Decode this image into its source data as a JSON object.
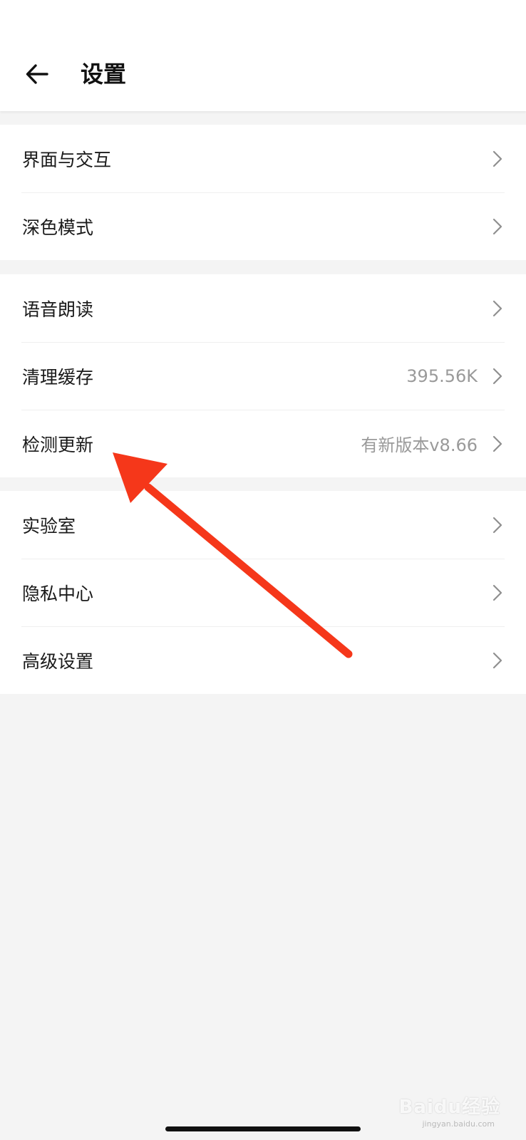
{
  "header": {
    "title": "设置",
    "back_icon": "arrow-left-icon"
  },
  "groups": [
    {
      "items": [
        {
          "label": "界面与交互",
          "value": ""
        },
        {
          "label": "深色模式",
          "value": ""
        }
      ]
    },
    {
      "items": [
        {
          "label": "语音朗读",
          "value": ""
        },
        {
          "label": "清理缓存",
          "value": "395.56K"
        },
        {
          "label": "检测更新",
          "value": "有新版本v8.66"
        }
      ]
    },
    {
      "items": [
        {
          "label": "实验室",
          "value": ""
        },
        {
          "label": "隐私中心",
          "value": ""
        },
        {
          "label": "高级设置",
          "value": ""
        }
      ]
    }
  ],
  "annotation": {
    "color": "#f5371a",
    "points_to": "检测更新"
  },
  "watermark": {
    "text": "Baidu经验",
    "sub": "jingyan.baidu.com"
  },
  "colors": {
    "background": "#f4f4f4",
    "surface": "#ffffff",
    "text_primary": "#1a1a1a",
    "text_secondary": "#9a9a9a"
  }
}
